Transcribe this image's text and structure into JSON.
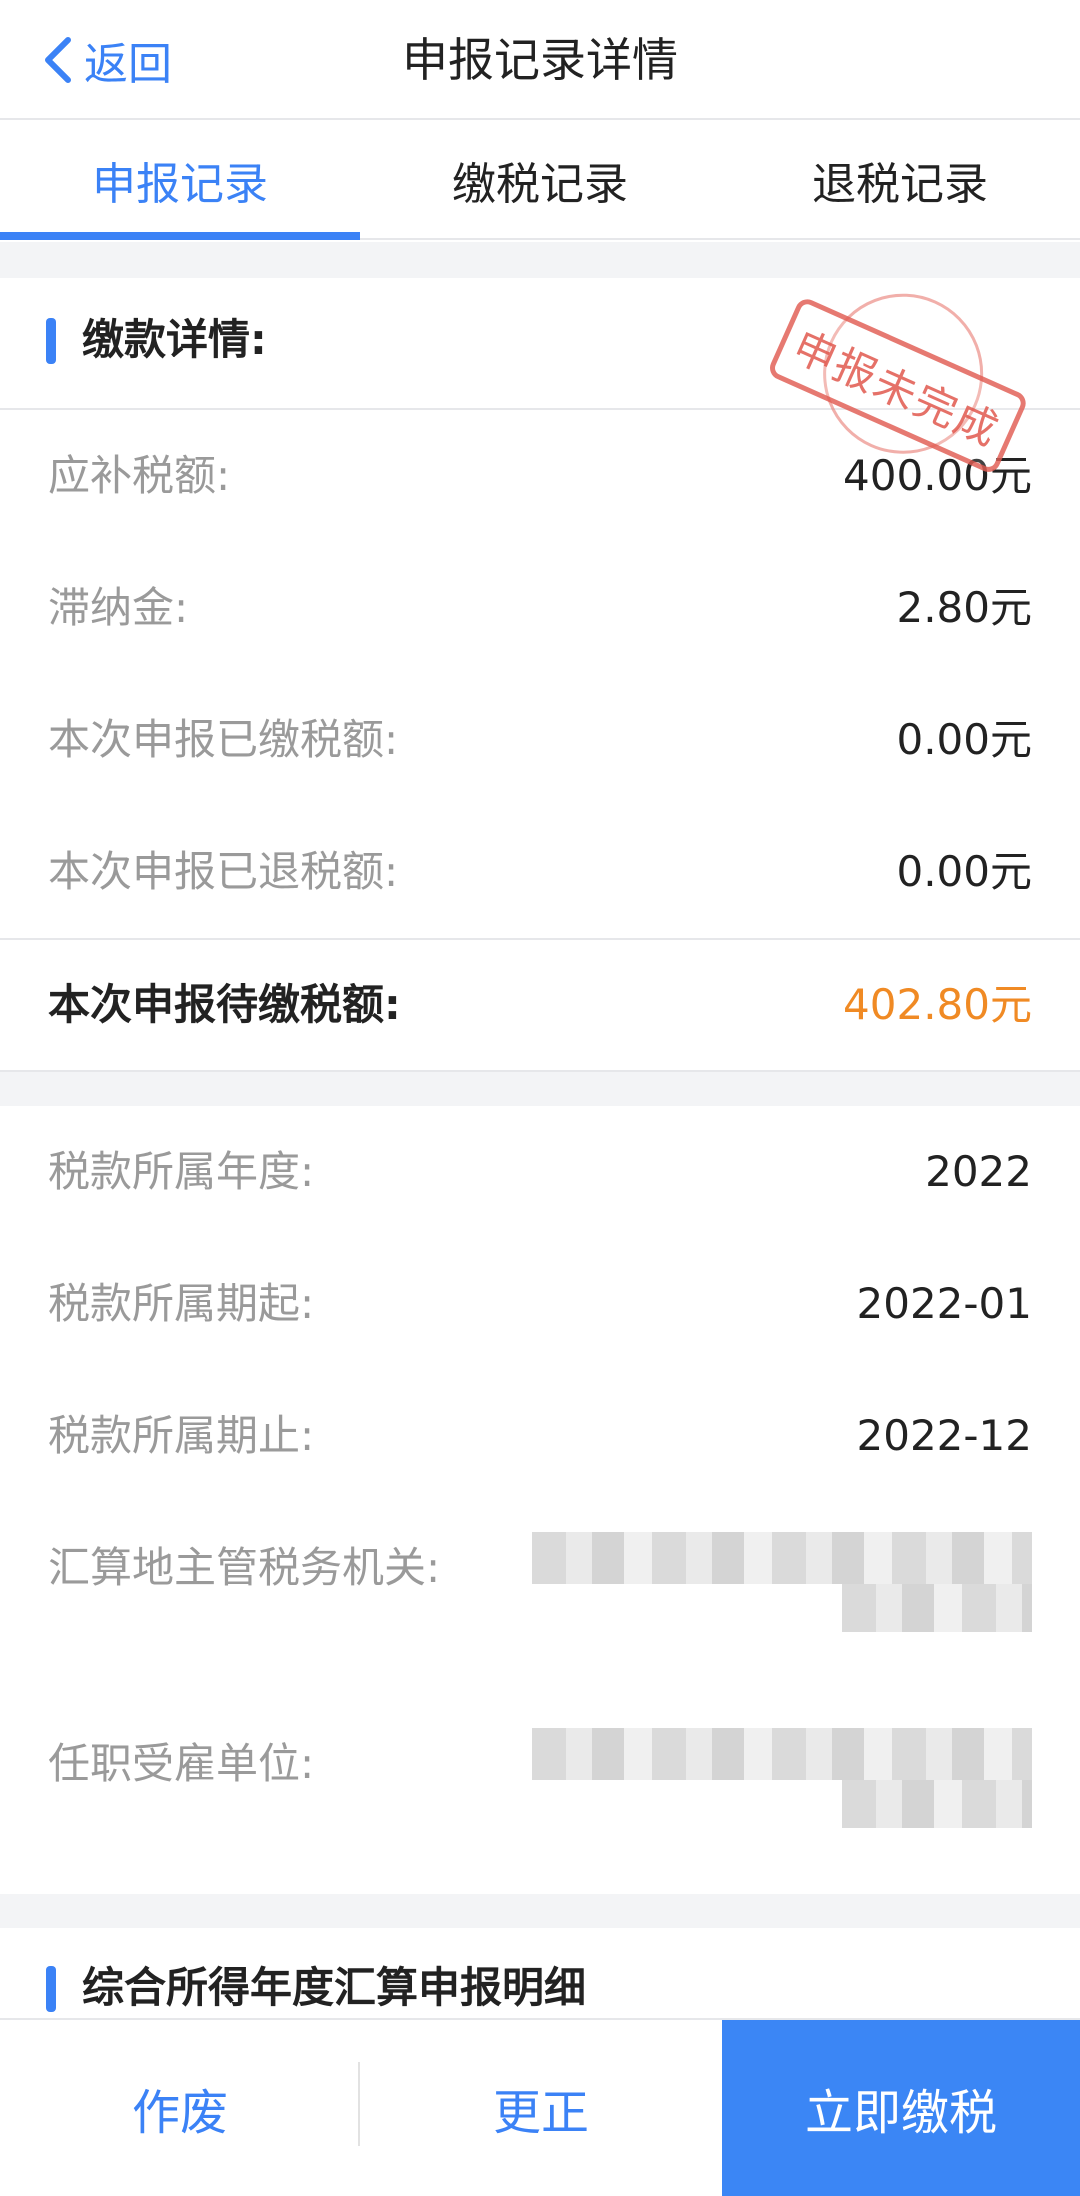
{
  "header": {
    "back_label": "返回",
    "title": "申报记录详情"
  },
  "tabs": [
    {
      "label": "申报记录",
      "active": true
    },
    {
      "label": "缴税记录",
      "active": false
    },
    {
      "label": "退税记录",
      "active": false
    }
  ],
  "section1": {
    "title": "缴款详情:",
    "stamp_text": "申报未完成",
    "rows": [
      {
        "label": "应补税额:",
        "value": "400.00元"
      },
      {
        "label": "滞纳金:",
        "value": "2.80元"
      },
      {
        "label": "本次申报已缴税额:",
        "value": "0.00元"
      },
      {
        "label": "本次申报已退税额:",
        "value": "0.00元"
      }
    ],
    "total": {
      "label": "本次申报待缴税额:",
      "value": "402.80元"
    }
  },
  "section_info": {
    "rows": [
      {
        "label": "税款所属年度:",
        "value": "2022"
      },
      {
        "label": "税款所属期起:",
        "value": "2022-01"
      },
      {
        "label": "税款所属期止:",
        "value": "2022-12"
      },
      {
        "label": "汇算地主管税务机关:",
        "value": ""
      },
      {
        "label": "任职受雇单位:",
        "value": ""
      }
    ]
  },
  "section2": {
    "title": "综合所得年度汇算申报明细"
  },
  "bottom_bar": {
    "void_label": "作废",
    "correct_label": "更正",
    "pay_label": "立即缴税"
  },
  "colors": {
    "accent": "#3b82f6",
    "pending_amount": "#f08a24",
    "stamp": "#e0584e"
  }
}
